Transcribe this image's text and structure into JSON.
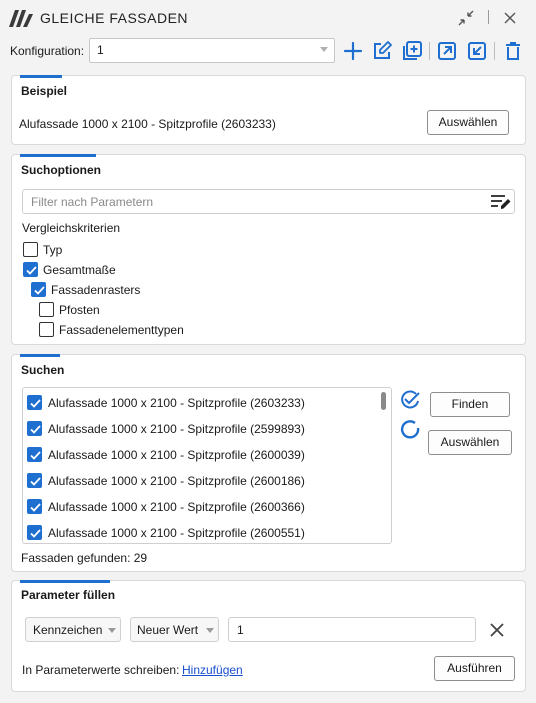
{
  "window": {
    "title": "GLEICHE FASSADEN"
  },
  "icons": {
    "logo": "logo-icon",
    "collapse": "collapse-icon",
    "close": "close-icon",
    "add": "plus-icon",
    "edit": "edit-icon",
    "duplicate": "duplicate-icon",
    "export": "export-icon",
    "import": "import-icon",
    "delete": "trash-icon",
    "filter_edit": "filter-edit-icon",
    "check_all": "check-all-icon",
    "uncheck_all": "uncheck-all-icon",
    "clear": "clear-icon"
  },
  "colors": {
    "accent": "#1f6fd1",
    "link": "#1a4fd0"
  },
  "config": {
    "label": "Konfiguration:",
    "value": "1"
  },
  "example": {
    "title": "Beispiel",
    "text": "Alufassade 1000 x 2100 - Spitzprofile (2603233)",
    "select_label": "Auswählen"
  },
  "search_options": {
    "title": "Suchoptionen",
    "filter_placeholder": "Filter nach Parametern",
    "criteria_label": "Vergleichskriterien",
    "criteria": [
      {
        "label": "Typ",
        "checked": false
      },
      {
        "label": "Gesamtmaße",
        "checked": true
      },
      {
        "label": "Fassadenrasters",
        "checked": true
      },
      {
        "label": "Pfosten",
        "checked": false
      },
      {
        "label": "Fassadenelementtypen",
        "checked": false
      }
    ]
  },
  "search": {
    "title": "Suchen",
    "results": [
      {
        "label": "Alufassade 1000 x 2100 - Spitzprofile (2603233)",
        "checked": true
      },
      {
        "label": "Alufassade 1000 x 2100 - Spitzprofile (2599893)",
        "checked": true
      },
      {
        "label": "Alufassade 1000 x 2100 - Spitzprofile (2600039)",
        "checked": true
      },
      {
        "label": "Alufassade 1000 x 2100 - Spitzprofile (2600186)",
        "checked": true
      },
      {
        "label": "Alufassade 1000 x 2100 - Spitzprofile (2600366)",
        "checked": true
      },
      {
        "label": "Alufassade 1000 x 2100 - Spitzprofile (2600551)",
        "checked": true
      }
    ],
    "find_label": "Finden",
    "select_label": "Auswählen",
    "found_text": "Fassaden gefunden: 29"
  },
  "fill_params": {
    "title": "Parameter füllen",
    "param_dropdown": "Kennzeichen",
    "mode_dropdown": "Neuer Wert",
    "value": "1",
    "write_label": "In Parameterwerte schreiben:",
    "add_link": "Hinzufügen",
    "execute_label": "Ausführen"
  }
}
